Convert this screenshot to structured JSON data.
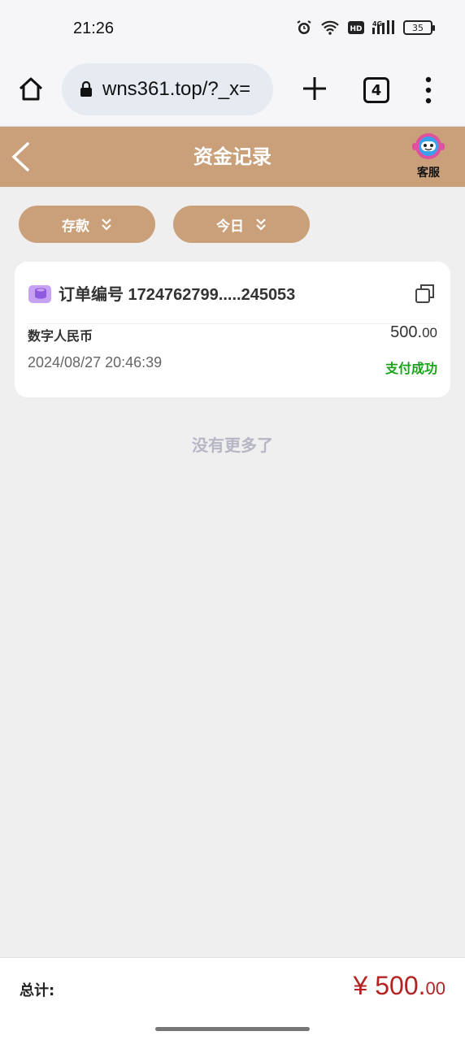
{
  "status_bar": {
    "time": "21:26",
    "battery": "35"
  },
  "browser": {
    "url": "wns361.top/?_x=",
    "tab_count": "4"
  },
  "header": {
    "title": "资金记录",
    "customer_service": "客服"
  },
  "filters": [
    {
      "label": "存款"
    },
    {
      "label": "今日"
    }
  ],
  "record": {
    "order_label": "订单编号 1724762799.....245053",
    "currency": "数字人民币",
    "amount_int": "500.",
    "amount_dec": "00",
    "datetime": "2024/08/27 20:46:39",
    "status": "支付成功"
  },
  "no_more": "没有更多了",
  "footer": {
    "total_label": "总计:",
    "total_int": "¥ 500.",
    "total_dec": "00"
  },
  "colors": {
    "accent": "#c9a07a",
    "success": "#1aa31a",
    "total": "#b42323"
  }
}
